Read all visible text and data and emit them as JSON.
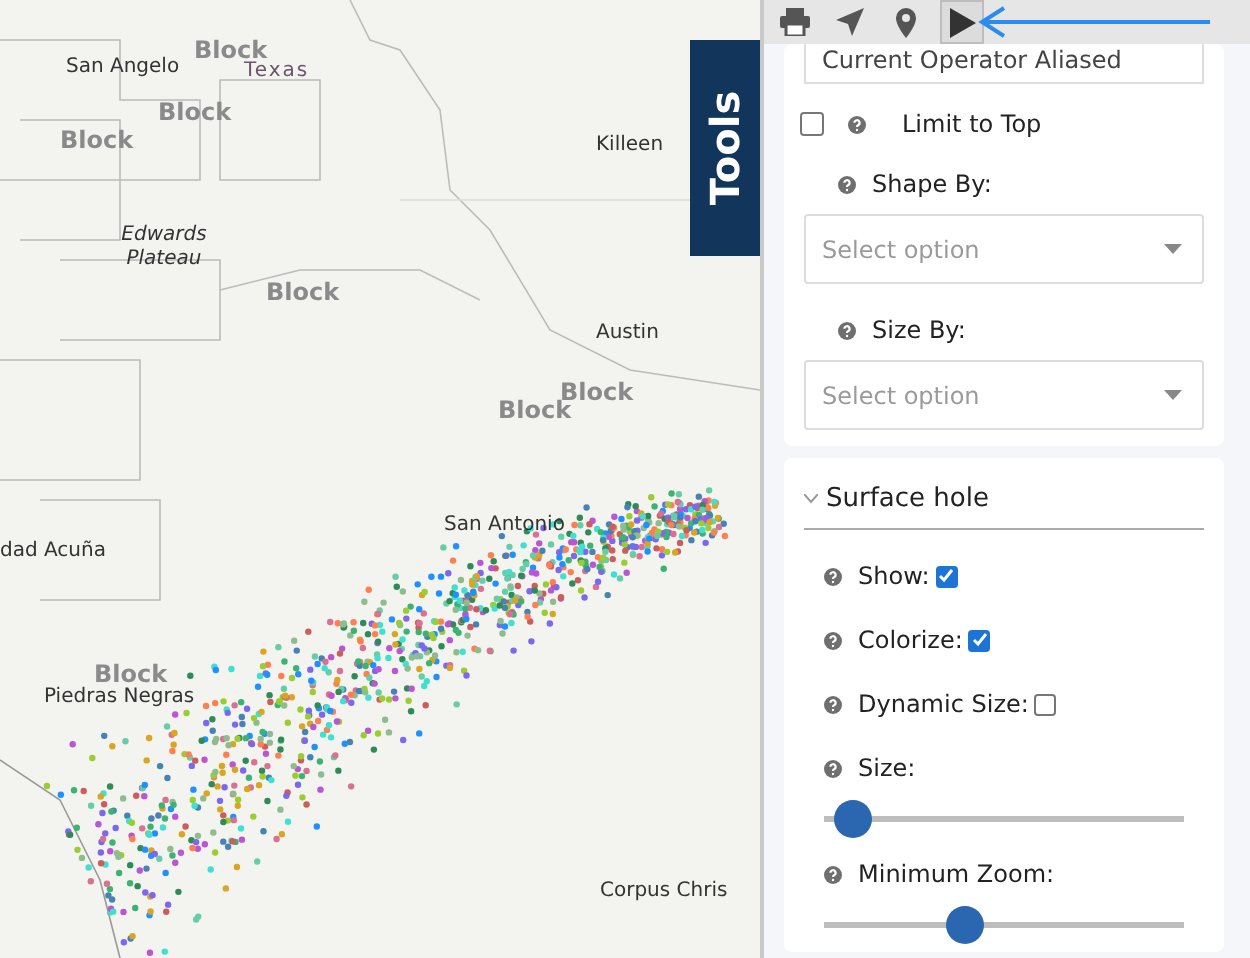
{
  "map": {
    "labels": [
      {
        "text": "Block",
        "kind": "block"
      },
      {
        "text": "San Angelo",
        "kind": "city"
      },
      {
        "text": "Texas",
        "kind": "state"
      },
      {
        "text": "Block",
        "kind": "block"
      },
      {
        "text": "Block",
        "kind": "block"
      },
      {
        "text": "Edwards Plateau",
        "kind": "region"
      },
      {
        "text": "Block",
        "kind": "block"
      },
      {
        "text": "Killeen",
        "kind": "city"
      },
      {
        "text": "Austin",
        "kind": "city"
      },
      {
        "text": "Block",
        "kind": "block"
      },
      {
        "text": "Block",
        "kind": "block"
      },
      {
        "text": "San Antonio",
        "kind": "city"
      },
      {
        "text": "dad Acuña",
        "kind": "city"
      },
      {
        "text": "Block",
        "kind": "block"
      },
      {
        "text": "Piedras Negras",
        "kind": "city"
      },
      {
        "text": "Corpus Chris",
        "kind": "city"
      }
    ],
    "tools_tab": "Tools"
  },
  "toolbar": {
    "buttons": [
      {
        "kind": "print",
        "selected": false
      },
      {
        "kind": "navigate",
        "selected": false
      },
      {
        "kind": "pin",
        "selected": false
      },
      {
        "kind": "play",
        "selected": true
      }
    ]
  },
  "panel": {
    "top_field": {
      "value": "Current Operator Aliased"
    },
    "limit_to_top": {
      "label": "Limit to Top",
      "checked": false
    },
    "shape_by": {
      "label": "Shape By:",
      "placeholder": "Select option"
    },
    "size_by": {
      "label": "Size By:",
      "placeholder": "Select option"
    },
    "surface_hole": {
      "title": "Surface hole",
      "expanded": true,
      "rows": [
        {
          "kind": "checkbox",
          "label": "Show:",
          "checked": true
        },
        {
          "kind": "checkbox",
          "label": "Colorize:",
          "checked": true
        },
        {
          "kind": "checkbox",
          "label": "Dynamic Size:",
          "checked": false
        },
        {
          "kind": "slider",
          "label": "Size:",
          "level": 0.08
        },
        {
          "kind": "slider",
          "label": "Minimum Zoom:",
          "level": 0.39
        }
      ]
    }
  }
}
